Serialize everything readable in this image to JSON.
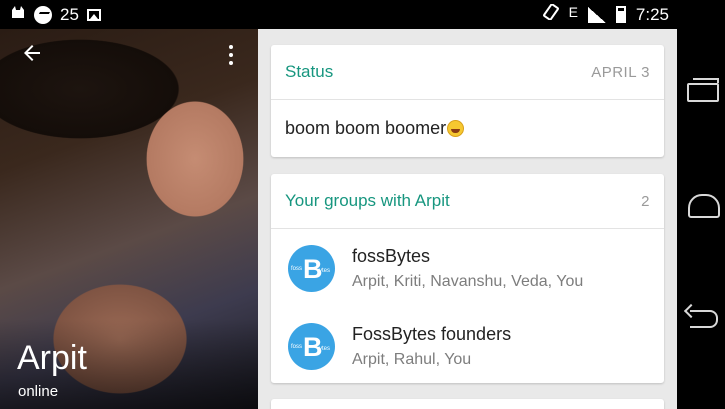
{
  "status_bar": {
    "notification_count": "25",
    "network_type": "E",
    "time": "7:25",
    "icons": [
      "cat-icon",
      "messenger-icon",
      "photo-icon",
      "rotate-icon",
      "signal-icon",
      "battery-icon"
    ]
  },
  "contact": {
    "name": "Arpit",
    "presence": "online"
  },
  "status_card": {
    "title": "Status",
    "date": "APRIL 3",
    "text": "boom boom boomer"
  },
  "groups_card": {
    "title": "Your groups with Arpit",
    "count": "2",
    "groups": [
      {
        "name": "fossBytes",
        "members": "Arpit, Kriti, Navanshu, Veda, You",
        "avatar_letter": "B",
        "avatar_left": "foss",
        "avatar_right": "ytes"
      },
      {
        "name": "FossBytes founders",
        "members": "Arpit, Rahul, You",
        "avatar_letter": "B",
        "avatar_left": "foss",
        "avatar_right": "ytes"
      }
    ]
  },
  "colors": {
    "accent": "#17967f",
    "group_avatar": "#3aa4e4",
    "background": "#e9e9e9"
  }
}
